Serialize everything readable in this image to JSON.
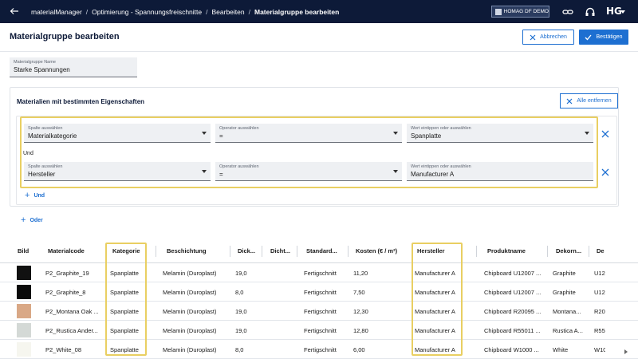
{
  "topbar": {
    "breadcrumbs": [
      "materialManager",
      "Optimierung - Spannungsfreischnitte",
      "Bearbeiten",
      "Materialgruppe bearbeiten"
    ],
    "tenant": "HOMAG DF DEMO",
    "logo": "HG"
  },
  "header": {
    "title": "Materialgruppe bearbeiten",
    "cancel_label": "Abbrechen",
    "confirm_label": "Bestätigen"
  },
  "name_field": {
    "label": "Materialgruppe Name",
    "value": "Starke Spannungen"
  },
  "group": {
    "title": "Materialien mit bestimmten Eigenschaften",
    "clear_label": "Alle entfernen",
    "and_label": "Und",
    "add_and_label": "Und",
    "add_or_label": "Oder",
    "conditions": [
      {
        "column": {
          "label": "Spalte auswählen",
          "value": "Materialkategorie"
        },
        "operator": {
          "label": "Operator auswählen",
          "value": "="
        },
        "value": {
          "label": "Wert eintippen oder auswählen",
          "value": "Spanplatte"
        }
      },
      {
        "column": {
          "label": "Spalte auswählen",
          "value": "Hersteller"
        },
        "operator": {
          "label": "Operator auswählen",
          "value": "="
        },
        "value": {
          "label": "Wert eintippen oder auswählen",
          "value": "Manufacturer A"
        }
      }
    ]
  },
  "table": {
    "headers": [
      "Bild",
      "Materialcode",
      "Kategorie",
      "Beschichtung",
      "Dick...",
      "Dicht...",
      "Standard...",
      "Kosten (€ / m²)",
      "Hersteller",
      "Produktname",
      "Dekorn...",
      "De"
    ],
    "rows": [
      {
        "swatch": "#111111",
        "code": "P2_Graphite_19",
        "kategorie": "Spanplatte",
        "beschichtung": "Melamin (Duroplast)",
        "dicke": "19,0",
        "dichte": "",
        "standard": "Fertigschnitt",
        "kosten": "11,20",
        "hersteller": "Manufacturer A",
        "produkt": "Chipboard U12007 ...",
        "dekor": "Graphite",
        "de": "U12"
      },
      {
        "swatch": "#0a0a0a",
        "code": "P2_Graphite_8",
        "kategorie": "Spanplatte",
        "beschichtung": "Melamin (Duroplast)",
        "dicke": "8,0",
        "dichte": "",
        "standard": "Fertigschnitt",
        "kosten": "7,50",
        "hersteller": "Manufacturer A",
        "produkt": "Chipboard U12007 ...",
        "dekor": "Graphite",
        "de": "U12"
      },
      {
        "swatch": "#d9a886",
        "code": "P2_Montana Oak ...",
        "kategorie": "Spanplatte",
        "beschichtung": "Melamin (Duroplast)",
        "dicke": "19,0",
        "dichte": "",
        "standard": "Fertigschnitt",
        "kosten": "12,30",
        "hersteller": "Manufacturer A",
        "produkt": "Chipboard R20095 ...",
        "dekor": "Montana...",
        "de": "R20"
      },
      {
        "swatch": "#d4d9d6",
        "code": "P2_Rustica Ander...",
        "kategorie": "Spanplatte",
        "beschichtung": "Melamin (Duroplast)",
        "dicke": "19,0",
        "dichte": "",
        "standard": "Fertigschnitt",
        "kosten": "12,80",
        "hersteller": "Manufacturer A",
        "produkt": "Chipboard R55011 ...",
        "dekor": "Rustica A...",
        "de": "R55"
      },
      {
        "swatch": "#f6f6ef",
        "code": "P2_White_08",
        "kategorie": "Spanplatte",
        "beschichtung": "Melamin (Duroplast)",
        "dicke": "8,0",
        "dichte": "",
        "standard": "Fertigschnitt",
        "kosten": "6,00",
        "hersteller": "Manufacturer A",
        "produkt": "Chipboard W1000 ...",
        "dekor": "White",
        "de": "W10"
      }
    ]
  },
  "colors": {
    "navy": "#0d1a38",
    "accent": "#1d6fd1",
    "highlight": "#e9cf62"
  }
}
